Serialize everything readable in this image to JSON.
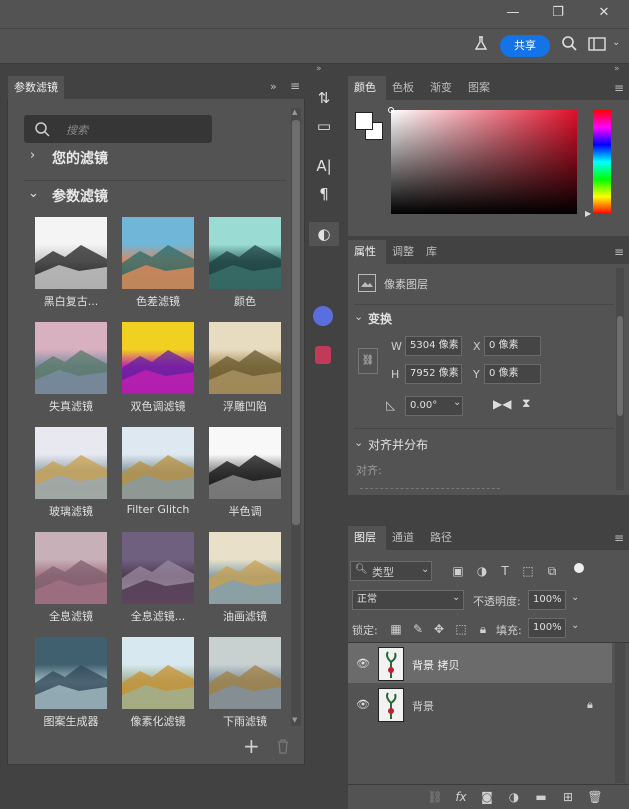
{
  "toolbar": {
    "share_label": "共享"
  },
  "filters_panel": {
    "tab_label": "参数滤镜",
    "search_placeholder": "搜索",
    "your_filters_label": "您的滤镜",
    "param_filters_label": "参数滤镜",
    "items": [
      {
        "label": "黑白复古..."
      },
      {
        "label": "色差滤镜"
      },
      {
        "label": "颜色"
      },
      {
        "label": "失真滤镜"
      },
      {
        "label": "双色调滤镜"
      },
      {
        "label": "浮雕凹陷"
      },
      {
        "label": "玻璃滤镜"
      },
      {
        "label": "Filter Glitch"
      },
      {
        "label": "半色调"
      },
      {
        "label": "全息滤镜"
      },
      {
        "label": "全息滤镜..."
      },
      {
        "label": "油画滤镜"
      },
      {
        "label": "图案生成器"
      },
      {
        "label": "像素化滤镜"
      },
      {
        "label": "下雨滤镜"
      }
    ]
  },
  "color_panel": {
    "tabs": [
      "颜色",
      "色板",
      "渐变",
      "图案"
    ]
  },
  "properties_panel": {
    "tabs": [
      "属性",
      "调整",
      "库"
    ],
    "layer_type": "像素图层",
    "transform_label": "变换",
    "w_label": "W",
    "w_value": "5304 像素",
    "h_label": "H",
    "h_value": "7952 像素",
    "x_label": "X",
    "x_value": "0 像素",
    "y_label": "Y",
    "y_value": "0 像素",
    "angle_value": "0.00°",
    "align_label": "对齐并分布",
    "align_sub": "对齐:"
  },
  "layers_panel": {
    "tabs": [
      "图层",
      "通道",
      "路径"
    ],
    "filter_type": "类型",
    "blend_mode": "正常",
    "opacity_label": "不透明度:",
    "opacity_value": "100%",
    "lock_label": "锁定:",
    "fill_label": "填充:",
    "fill_value": "100%",
    "layers": [
      {
        "name": "背景 拷贝"
      },
      {
        "name": "背景"
      }
    ]
  }
}
